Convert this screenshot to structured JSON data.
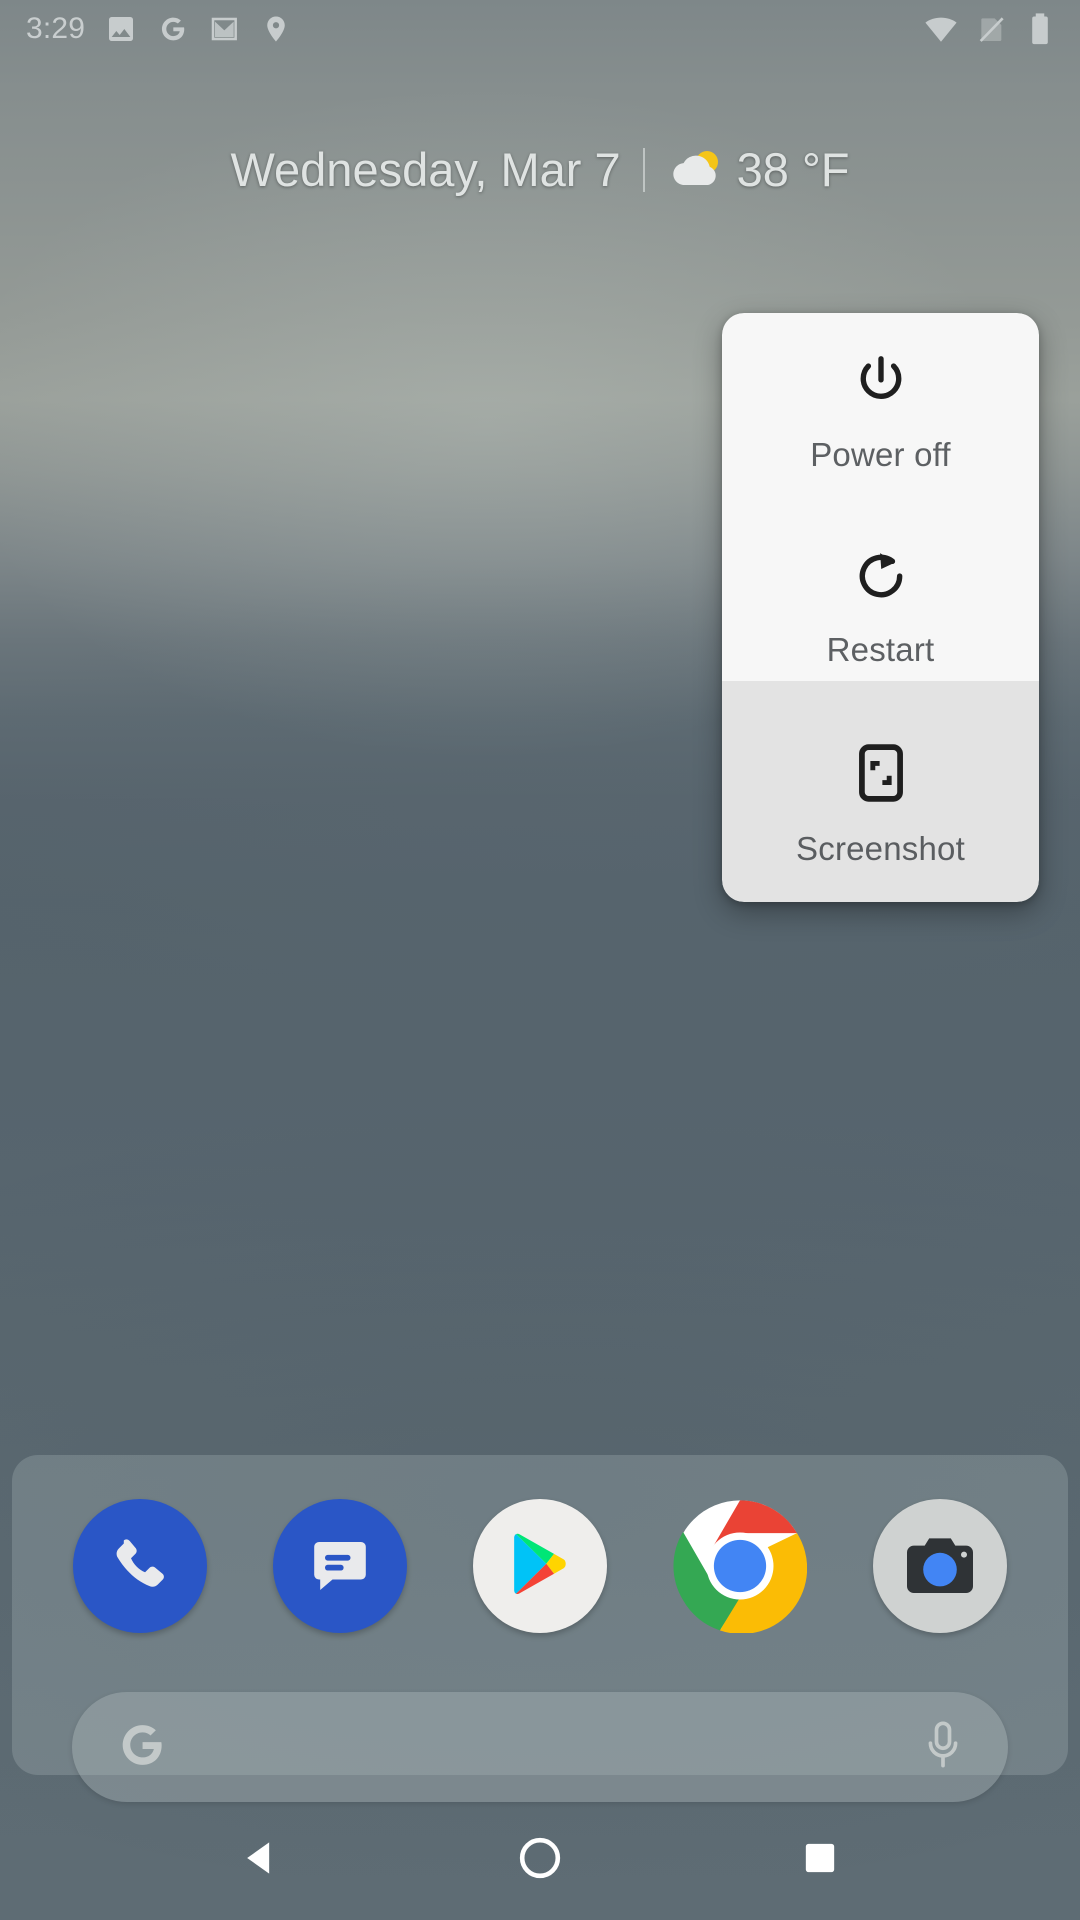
{
  "status_bar": {
    "clock": "3:29",
    "left_icons": [
      {
        "name": "photos-icon",
        "glyph": "image"
      },
      {
        "name": "google-icon",
        "glyph": "G"
      },
      {
        "name": "gmail-icon",
        "glyph": "envelope"
      },
      {
        "name": "location-icon",
        "glyph": "pin"
      }
    ],
    "right_icons": [
      {
        "name": "wifi-icon",
        "glyph": "wifi"
      },
      {
        "name": "no-sim-icon",
        "glyph": "signal-off"
      },
      {
        "name": "battery-icon",
        "glyph": "battery-full"
      }
    ],
    "icon_color": "#c7cccd"
  },
  "date_widget": {
    "date": "Wednesday, Mar 7",
    "separator": "|",
    "weather_icon": "partly-cloudy-icon",
    "temperature": "38 °F",
    "text_color": "#dfe3e2"
  },
  "power_menu": {
    "items": [
      {
        "id": "power-off",
        "label": "Power off",
        "icon": "power-icon",
        "section": "light"
      },
      {
        "id": "restart",
        "label": "Restart",
        "icon": "restart-icon",
        "section": "light"
      },
      {
        "id": "screenshot",
        "label": "Screenshot",
        "icon": "screenshot-icon",
        "section": "dark"
      }
    ],
    "light_bg": "#f7f7f7",
    "dark_bg": "#e3e3e3",
    "label_color": "#5d6063"
  },
  "dock": {
    "apps": [
      {
        "id": "phone",
        "label": "Phone",
        "icon": "phone-icon",
        "color": "#2a56c6"
      },
      {
        "id": "messages",
        "label": "Messages",
        "icon": "message-icon",
        "color": "#2a56c6"
      },
      {
        "id": "play",
        "label": "Play Store",
        "icon": "play-store-icon",
        "color": "#efeeec"
      },
      {
        "id": "chrome",
        "label": "Chrome",
        "icon": "chrome-icon",
        "color": "#ffffff"
      },
      {
        "id": "camera",
        "label": "Camera",
        "icon": "camera-icon",
        "color": "#cfd2d1"
      }
    ]
  },
  "search": {
    "logo": "google-g-icon",
    "placeholder": "",
    "value": "",
    "mic_icon": "microphone-icon"
  },
  "nav_bar": {
    "buttons": [
      {
        "id": "back",
        "label": "Back",
        "icon": "back-triangle-icon"
      },
      {
        "id": "home",
        "label": "Home",
        "icon": "home-circle-icon"
      },
      {
        "id": "recents",
        "label": "Recents",
        "icon": "recents-square-icon"
      }
    ],
    "color": "#ffffff"
  }
}
